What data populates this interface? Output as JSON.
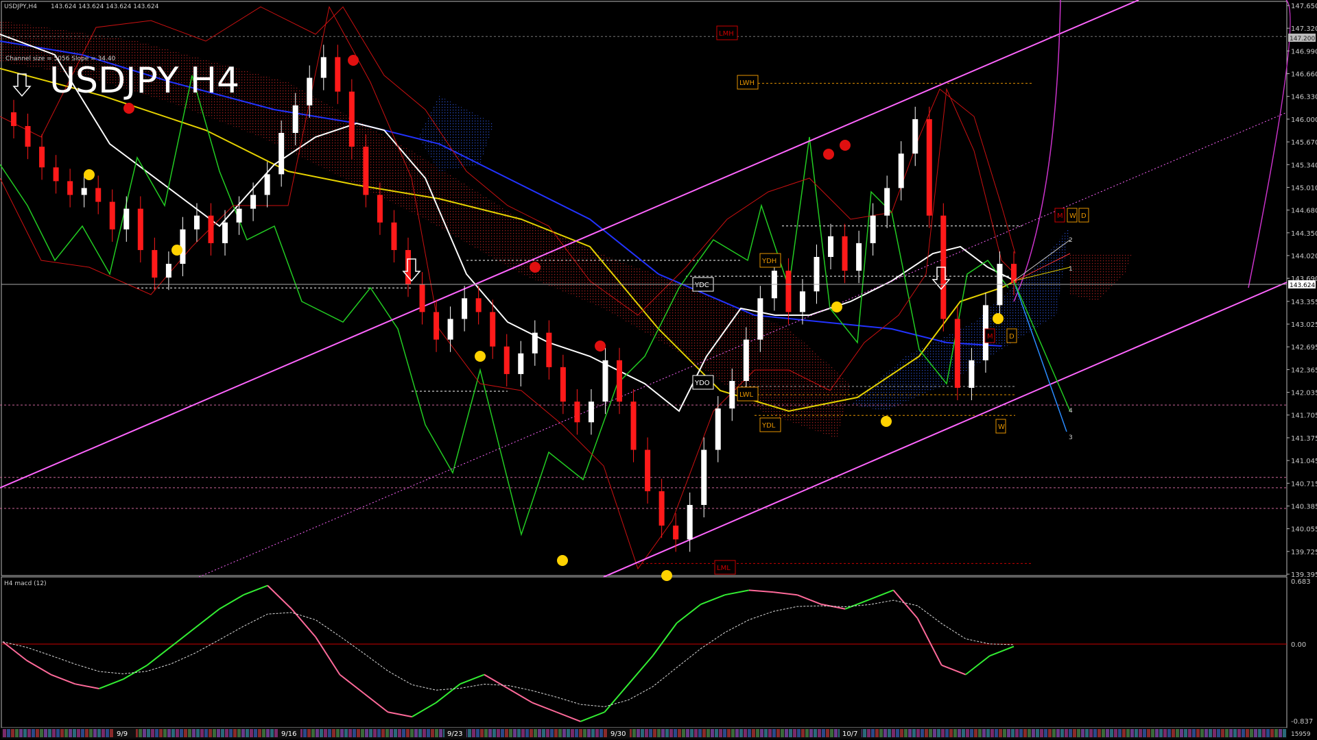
{
  "window": {
    "symbol_header": "USDJPY,H4",
    "ohlc_readout": "143.624 143.624 143.624 143.624",
    "title": "USDJPY H4",
    "channel_info": "Channel size = 5056  Slope = 34.40"
  },
  "subwindow": {
    "label": "H4  macd (12)",
    "scale_top": "0.683",
    "scale_zero": "0.00",
    "scale_bottom": "-0.837"
  },
  "price_axis": {
    "ticks": [
      "147.650",
      "147.320",
      "146.990",
      "146.660",
      "146.330",
      "146.000",
      "145.670",
      "145.340",
      "145.010",
      "144.680",
      "144.350",
      "144.020",
      "143.690",
      "143.355",
      "143.025",
      "142.695",
      "142.365",
      "142.035",
      "141.705",
      "141.375",
      "141.045",
      "140.715",
      "140.385",
      "140.055",
      "139.725",
      "139.395"
    ],
    "current_price": "143.624",
    "tag_top": "147.200"
  },
  "date_axis": {
    "labels": [
      "9/9",
      "9/16",
      "9/23",
      "9/30",
      "10/7"
    ],
    "corner_value": "15959"
  },
  "levels": {
    "tags": [
      "LMH",
      "LWH",
      "YDH",
      "YDC",
      "YDO",
      "LWL",
      "YDL",
      "LML",
      "M",
      "W",
      "D",
      "M",
      "D",
      "W"
    ],
    "projection_labels": [
      "1",
      "2",
      "3",
      "4"
    ]
  },
  "colors": {
    "bull_candle": "#ffffff",
    "bear_candle": "#ff1a1a",
    "channel": "#ff66ff",
    "ma_blue": "#2233ff",
    "ma_yellow": "#e6d200",
    "ma_white": "#ffffff",
    "green_line": "#22cc22",
    "macd_pos": "#33ee33",
    "macd_neg": "#ff6a9a",
    "grid": "#555555",
    "level_orange": "#e69500",
    "level_red": "#cc0000"
  },
  "chart_data": {
    "type": "candlestick",
    "title": "USDJPY H4",
    "ylim": [
      139.395,
      147.65
    ],
    "x_labels": [
      "9/9",
      "9/16",
      "9/23",
      "9/30",
      "10/7"
    ],
    "close_series": [
      145.9,
      145.6,
      145.3,
      145.1,
      144.9,
      145.0,
      144.8,
      144.4,
      144.7,
      144.1,
      143.7,
      143.9,
      144.4,
      144.6,
      144.2,
      144.5,
      144.7,
      144.9,
      145.2,
      145.8,
      146.2,
      146.6,
      146.9,
      146.4,
      145.6,
      144.9,
      144.5,
      144.1,
      143.6,
      143.2,
      142.8,
      143.1,
      143.4,
      143.2,
      142.7,
      142.3,
      142.6,
      142.9,
      142.4,
      141.9,
      141.6,
      141.9,
      142.5,
      141.9,
      141.2,
      140.6,
      140.1,
      139.9,
      140.4,
      141.2,
      141.8,
      142.2,
      142.8,
      143.4,
      143.8,
      143.2,
      143.5,
      144.0,
      144.3,
      143.8,
      144.2,
      144.6,
      145.0,
      145.5,
      146.0,
      144.6,
      143.1,
      142.1,
      142.5,
      143.3,
      143.9,
      143.624
    ],
    "macd": [
      0.05,
      -0.15,
      -0.3,
      -0.4,
      -0.45,
      -0.35,
      -0.2,
      0.0,
      0.2,
      0.4,
      0.55,
      0.65,
      0.4,
      0.1,
      -0.3,
      -0.5,
      -0.7,
      -0.75,
      -0.6,
      -0.4,
      -0.3,
      -0.45,
      -0.6,
      -0.7,
      -0.8,
      -0.7,
      -0.4,
      -0.1,
      0.25,
      0.45,
      0.55,
      0.6,
      0.58,
      0.55,
      0.45,
      0.4,
      0.5,
      0.6,
      0.3,
      -0.2,
      -0.3,
      -0.1,
      0.0
    ]
  }
}
